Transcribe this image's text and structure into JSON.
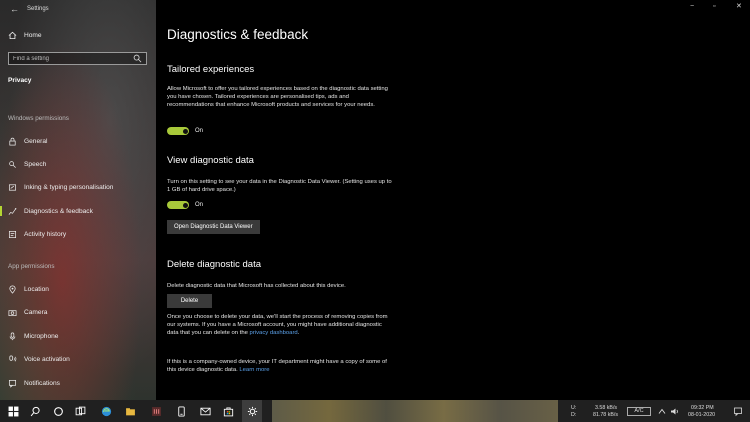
{
  "window": {
    "title": "Settings",
    "controls": {
      "minimize": "−",
      "maximize": "▫",
      "close": "✕"
    }
  },
  "sidebar": {
    "home_label": "Home",
    "search_placeholder": "Find a setting",
    "section_title": "Privacy",
    "windows_permissions_title": "Windows permissions",
    "windows_permissions": [
      {
        "label": "General",
        "icon": "lock-icon"
      },
      {
        "label": "Speech",
        "icon": "speech-icon"
      },
      {
        "label": "Inking & typing personalisation",
        "icon": "pen-icon"
      },
      {
        "label": "Diagnostics & feedback",
        "icon": "diagnostics-icon",
        "selected": true
      },
      {
        "label": "Activity history",
        "icon": "history-icon"
      }
    ],
    "app_permissions_title": "App permissions",
    "app_permissions": [
      {
        "label": "Location",
        "icon": "location-icon"
      },
      {
        "label": "Camera",
        "icon": "camera-icon"
      },
      {
        "label": "Microphone",
        "icon": "microphone-icon"
      },
      {
        "label": "Voice activation",
        "icon": "voice-activation-icon"
      },
      {
        "label": "Notifications",
        "icon": "notifications-icon"
      }
    ],
    "accent_color": "#b5d533"
  },
  "main": {
    "page_title": "Diagnostics & feedback",
    "tailored": {
      "heading": "Tailored experiences",
      "description": "Allow Microsoft to offer you tailored experiences based on the diagnostic data setting you have chosen. Tailored experiences are personalised tips, ads and recommendations that enhance Microsoft products and services for your needs.",
      "toggle_state": "On"
    },
    "view_diag": {
      "heading": "View diagnostic data",
      "description": "Turn on this setting to see your data in the Diagnostic Data Viewer. (Setting uses up to 1 GB of hard drive space.)",
      "toggle_state": "On",
      "button_label": "Open Diagnostic Data Viewer"
    },
    "delete_diag": {
      "heading": "Delete diagnostic data",
      "description": "Delete diagnostic data that Microsoft has collected about this device.",
      "button_label": "Delete",
      "info_text": "Once you choose to delete your data, we'll start the process of removing copies from our systems. If you have a Microsoft account, you might have additional diagnostic data that you can delete on the",
      "privacy_link": "privacy dashboard",
      "info_end": ".",
      "company_text": "If this is a company-owned device, your IT department might have a copy of some of this device diagnostic data.",
      "learn_more": "Learn more"
    },
    "toggle_color": "#a8c93a"
  },
  "taskbar": {
    "pinned": [
      "windows-start-icon",
      "search-icon",
      "cortana-icon",
      "task-view-icon",
      "edge-icon",
      "file-explorer-icon",
      "app-icon",
      "app-icon",
      "phone-icon",
      "mail-icon",
      "store-icon",
      "settings-icon"
    ],
    "network_up": "3.58 kB/s",
    "network_down": "81.78 kB/s",
    "net_label_up": "U:",
    "net_label_down": "D:",
    "ac_badge": "A/C",
    "time": "09:32 PM",
    "date": "08-01-2020"
  }
}
